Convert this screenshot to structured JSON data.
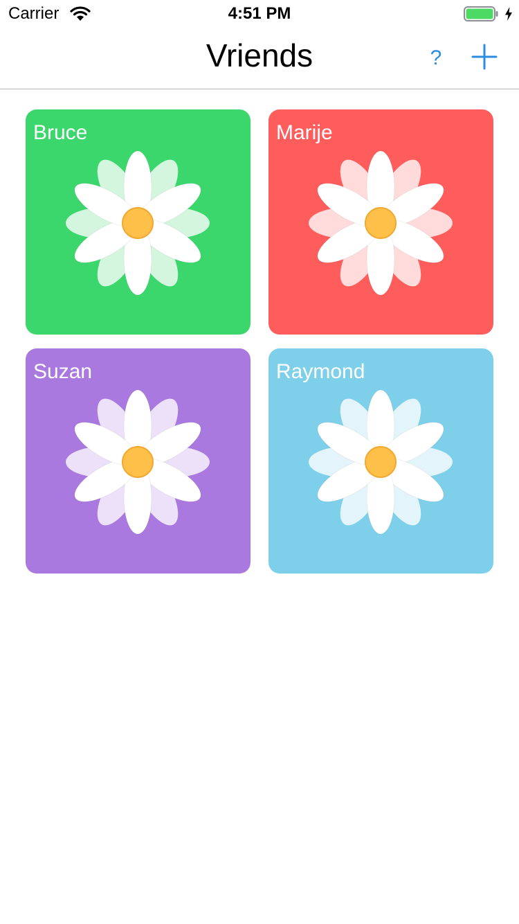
{
  "status_bar": {
    "carrier": "Carrier",
    "time": "4:51 PM",
    "battery_color": "#4cd964"
  },
  "nav": {
    "title": "Vriends",
    "help_label": "?",
    "accent_color": "#2a8de0"
  },
  "friends": [
    {
      "name": "Bruce",
      "color": "#3bd76c",
      "icon": "daisy-icon"
    },
    {
      "name": "Marije",
      "color": "#ff5c5c",
      "icon": "daisy-icon"
    },
    {
      "name": "Suzan",
      "color": "#a979df",
      "icon": "daisy-icon"
    },
    {
      "name": "Raymond",
      "color": "#7ecfea",
      "icon": "daisy-icon"
    }
  ]
}
